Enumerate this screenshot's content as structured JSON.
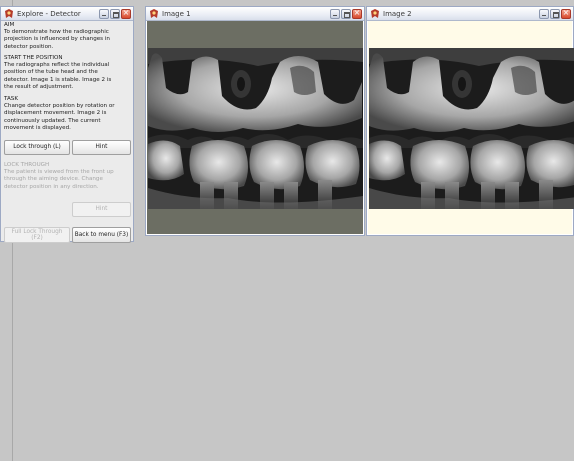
{
  "explorer": {
    "title": "Explore - Detector",
    "aim": [
      "AIM",
      "To demonstrate how the radiographic",
      "projection is influenced by changes in",
      "detector position."
    ],
    "start_position": [
      "START THE POSITION",
      "The radiographs reflect the individual",
      "position of the tube head and the",
      "detector. Image 1 is stable. Image 2 is",
      "the result of adjustment."
    ],
    "task": [
      "TASK",
      "Change detector position by rotation or",
      "displacement movement. Image 2 is",
      "continuously updated. The current",
      "movement is displayed."
    ],
    "buttons": {
      "lock_through": "Lock through (L)",
      "hint": "Hint"
    },
    "lock_through_text": [
      "LOCK THROUGH",
      "The patient is viewed from the front up",
      "through the aiming device. Change",
      "detector position in any direction."
    ],
    "buttons2": {
      "hint2": "Hint",
      "full_lock": "Full Lock Through (F2)",
      "back": "Back to menu (F3)"
    }
  },
  "image1": {
    "title": "Image 1"
  },
  "image2": {
    "title": "Image 2"
  },
  "icons": {
    "app": "xray-app-icon",
    "minimize": "minimize-icon",
    "maximize": "maximize-icon",
    "close": "close-icon"
  }
}
